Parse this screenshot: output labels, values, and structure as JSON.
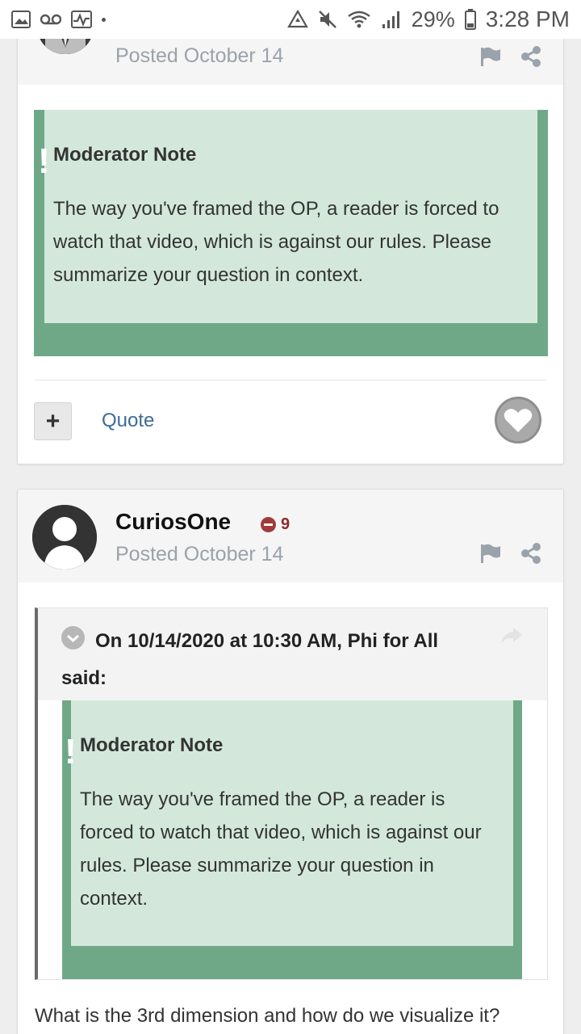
{
  "status_bar": {
    "battery": "29%",
    "time": "3:28 PM",
    "left_icons": [
      "image-icon",
      "voicemail-icon",
      "activity-icon"
    ],
    "right_icons": [
      "recycle-icon",
      "mute-icon",
      "wifi-icon",
      "signal-icon",
      "battery-icon"
    ]
  },
  "post1": {
    "posted": "Posted October 14",
    "mod_note": {
      "title": "Moderator Note",
      "body": "The way you've framed the OP, a reader is forced to watch that video, which is against our rules. Please summarize your question in context."
    },
    "actions": {
      "plus_label": "+",
      "quote_label": "Quote"
    }
  },
  "post2": {
    "author": "CuriosOne",
    "reputation": "9",
    "posted": "Posted October 14",
    "quote": {
      "citation": "On 10/14/2020 at 10:30 AM, Phi for All said:",
      "mod_note": {
        "title": "Moderator Note",
        "body": "The way you've framed the OP, a reader is forced to watch that video, which is against our rules. Please summarize your question in context."
      }
    },
    "body": "What is the 3rd dimension and how do we visualize it?"
  },
  "colors": {
    "mod_note_border": "#6fa886",
    "mod_note_bg": "#d3e8db",
    "link": "#3f6c96",
    "reputation": "#a23a3a"
  }
}
